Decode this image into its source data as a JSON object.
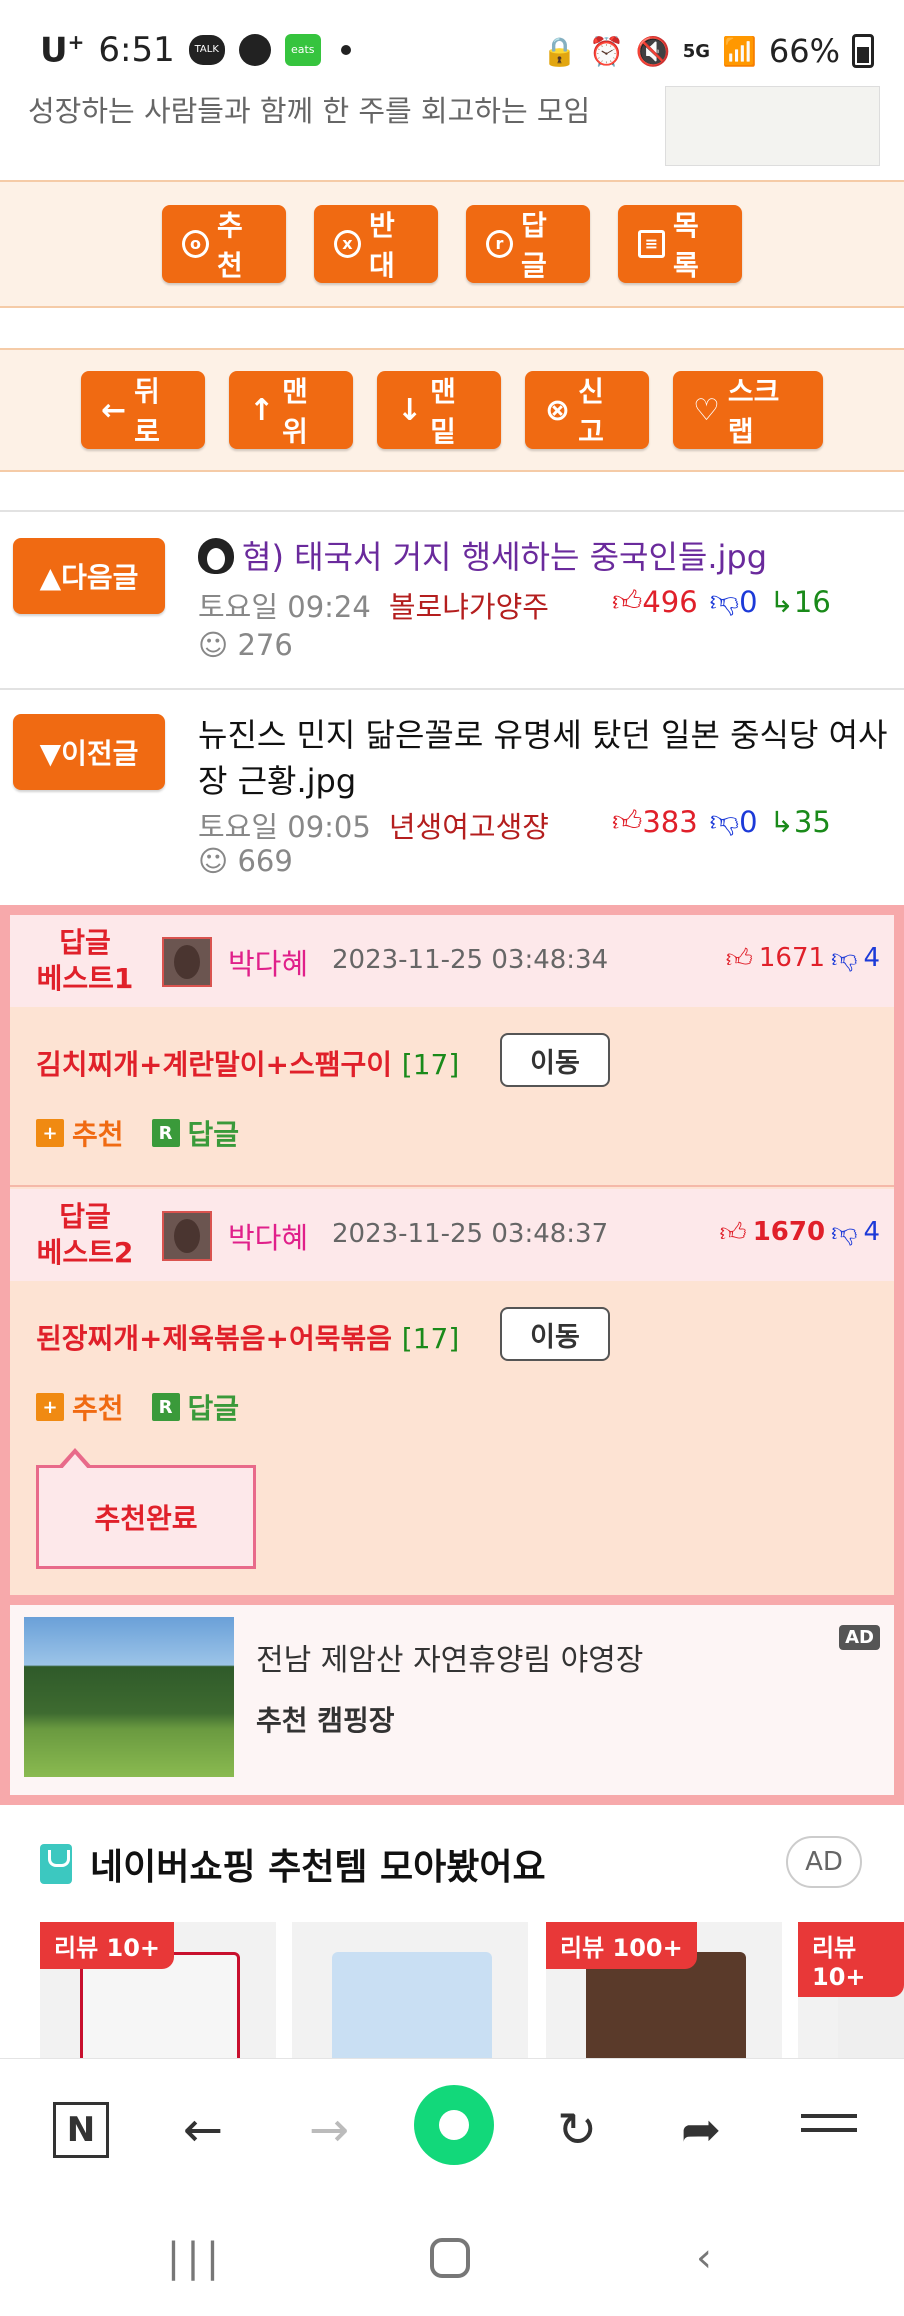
{
  "status_bar": {
    "carrier": "U",
    "carrier_sup": "+",
    "time": "6:51",
    "talk_label": "TALK",
    "eats_label": "eats",
    "network": "5G",
    "battery": "66%"
  },
  "header": {
    "description": "성장하는 사람들과 함께 한 주를 회고하는 모임"
  },
  "action_bar_1": {
    "buttons": [
      {
        "icon": "o",
        "label": "추천"
      },
      {
        "icon": "x",
        "label": "반대"
      },
      {
        "icon": "r",
        "label": "답글"
      },
      {
        "icon": "≡",
        "label": "목록"
      }
    ]
  },
  "action_bar_2": {
    "buttons": [
      {
        "icon": "←",
        "label": "뒤로"
      },
      {
        "icon": "↑",
        "label": "맨위"
      },
      {
        "icon": "↓",
        "label": "맨밑"
      },
      {
        "icon": "⊗",
        "label": "신고"
      },
      {
        "icon": "♡",
        "label": "스크랩"
      }
    ]
  },
  "next_post": {
    "button_label": "▲다음글",
    "title": "혐) 태국서 거지 행세하는 중국인들.jpg",
    "day_time": "토요일 09:24",
    "author": "볼로냐가양주",
    "upvotes": "496",
    "downvotes": "0",
    "replies": "16",
    "views": "276"
  },
  "prev_post": {
    "button_label": "▼이전글",
    "title": "뉴진스 민지 닮은꼴로 유명세 탔던 일본 중식당 여사장 근황.jpg",
    "day_time": "토요일 09:05",
    "author": "년생여고생쟝",
    "upvotes": "383",
    "downvotes": "0",
    "replies": "35",
    "views": "669"
  },
  "best_replies": [
    {
      "label_line1": "답글",
      "label_line2": "베스트1",
      "author": "박다혜",
      "datetime": "2023-11-25 03:48:34",
      "upvotes": "1671",
      "downvotes": "4",
      "title": "김치찌개+계란말이+스팸구이",
      "count": "[17]",
      "move_label": "이동",
      "recommend_label": "추천",
      "reply_label": "답글"
    },
    {
      "label_line1": "답글",
      "label_line2": "베스트2",
      "author": "박다혜",
      "datetime": "2023-11-25 03:48:37",
      "upvotes": "1670",
      "downvotes": "4",
      "title": "된장찌개+제육볶음+어묵볶음",
      "count": "[17]",
      "move_label": "이동",
      "recommend_label": "추천",
      "reply_label": "답글",
      "recommend_done_label": "추천완료"
    }
  ],
  "ad": {
    "title": "전남 제암산 자연휴양림 야영장",
    "subtitle": "추천 캠핑장",
    "tag": "AD"
  },
  "naver_shopping": {
    "title": "네이버쇼핑 추천템 모아봤어요",
    "ad_label": "AD",
    "products": [
      {
        "badge": "리뷰 10+"
      },
      {
        "badge": ""
      },
      {
        "badge": "리뷰 100+"
      },
      {
        "badge": "리뷰 10+"
      }
    ]
  },
  "browser_toolbar": {
    "n_label": "N"
  }
}
